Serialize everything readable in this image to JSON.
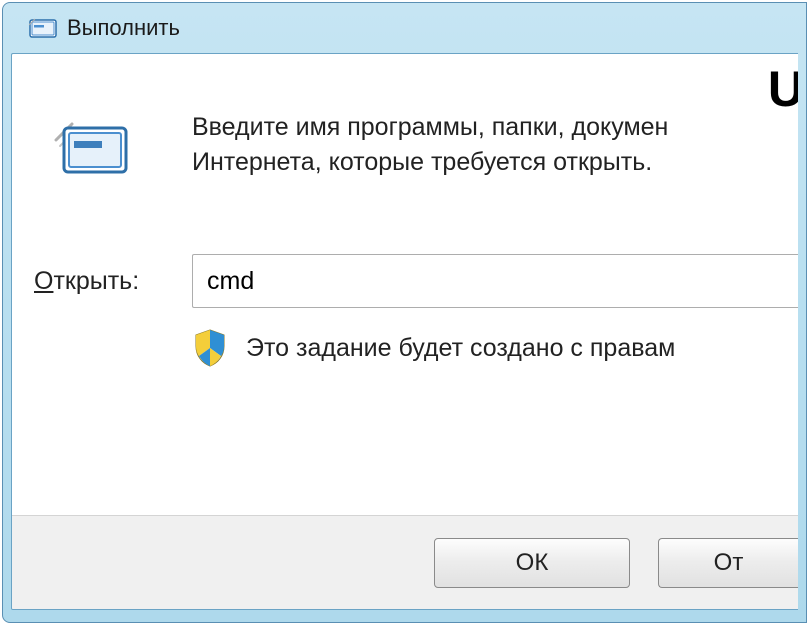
{
  "window": {
    "title": "Выполнить"
  },
  "corner_text": "U",
  "description": "Введите имя программы, папки, докумен\nИнтернета, которые требуется открыть.",
  "input": {
    "label_prefix": "О",
    "label_rest": "ткрыть:",
    "value": "cmd"
  },
  "admin_note": "Это задание будет создано с правам",
  "buttons": {
    "ok": "ОК",
    "cancel": "От"
  }
}
